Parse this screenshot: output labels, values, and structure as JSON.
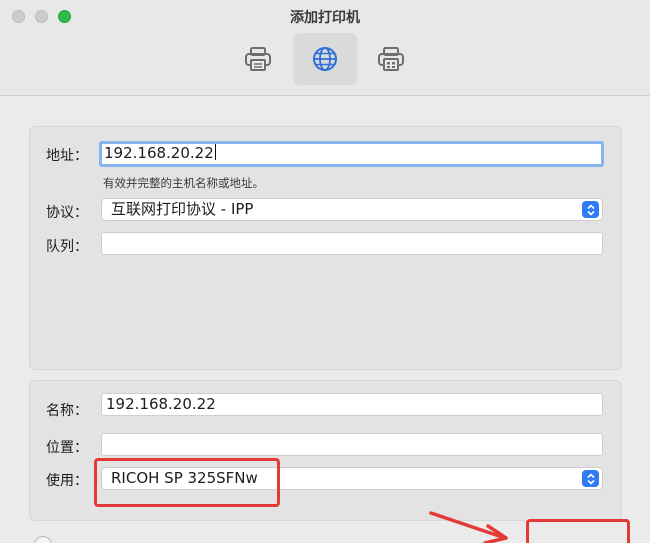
{
  "window": {
    "title": "添加打印机"
  },
  "toolbar": {
    "buttons": [
      {
        "icon": "printer-default-icon",
        "active": false
      },
      {
        "icon": "globe-ip-icon",
        "active": true
      },
      {
        "icon": "printer-windows-icon",
        "active": false
      }
    ]
  },
  "connection": {
    "address_label": "地址：",
    "address_value": "192.168.20.22",
    "address_hint": "有效并完整的主机名称或地址。",
    "protocol_label": "协议：",
    "protocol_value": "互联网打印协议 - IPP",
    "queue_label": "队列：",
    "queue_value": ""
  },
  "details": {
    "name_label": "名称：",
    "name_value": "192.168.20.22",
    "location_label": "位置：",
    "location_value": "",
    "use_label": "使用：",
    "use_value": "RICOH SP 325SFNw"
  },
  "colors": {
    "accent": "#2f7bf6",
    "focus_ring": "#8ab4ef",
    "annotation": "#e43a37",
    "traffic_green": "#2fb948"
  }
}
